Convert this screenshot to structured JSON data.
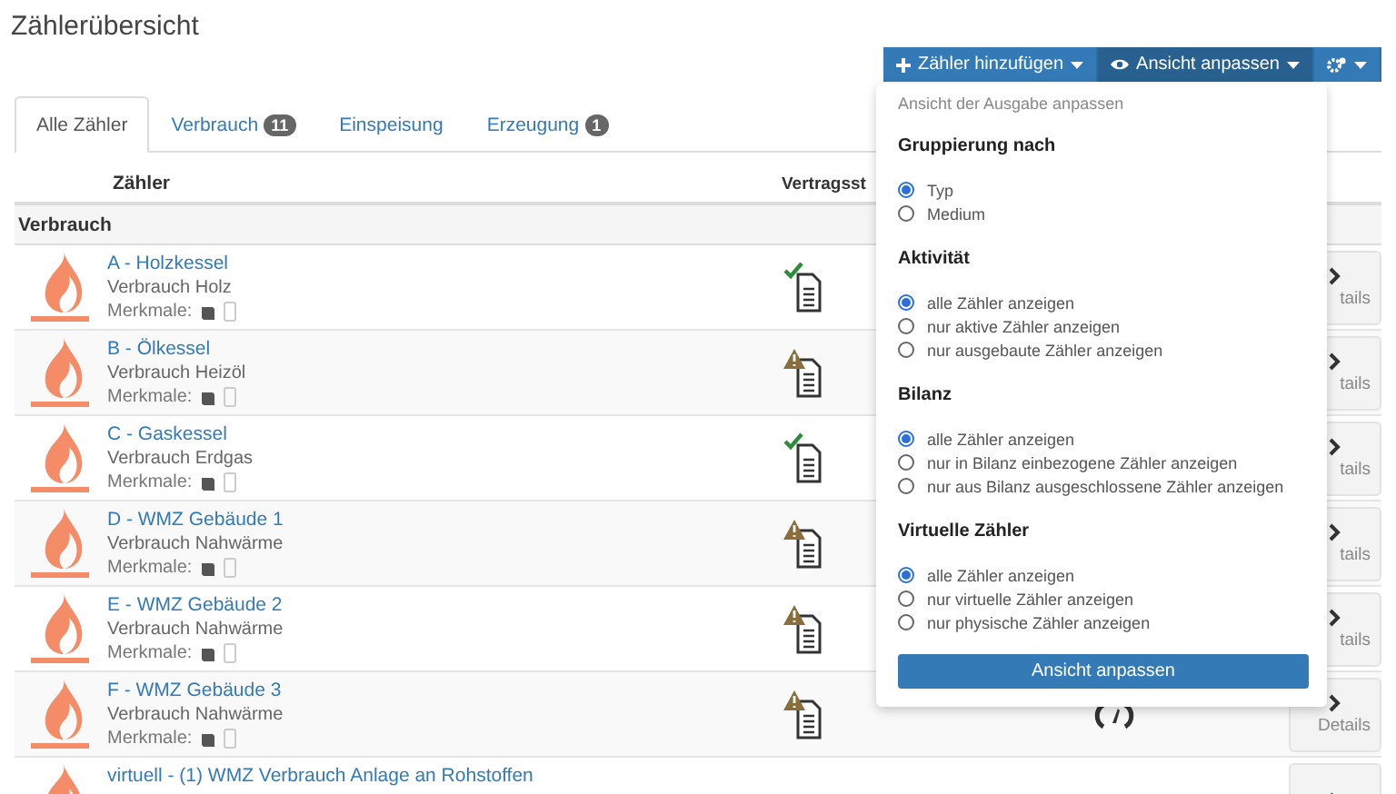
{
  "page": {
    "title": "Zählerübersicht"
  },
  "toolbar": [
    {
      "kind": "add",
      "label": "Zähler hinzufügen",
      "selected": false
    },
    {
      "kind": "view",
      "label": "Ansicht anpassen",
      "selected": true
    },
    {
      "kind": "settings",
      "selected": false
    }
  ],
  "tabs": [
    {
      "label": "Alle Zähler",
      "selected": true
    },
    {
      "label": "Verbrauch",
      "badge": "11",
      "selected": false
    },
    {
      "label": "Einspeisung",
      "selected": false
    },
    {
      "label": "Erzeugung",
      "badge": "1",
      "selected": false
    }
  ],
  "table": {
    "columns": [
      "Zähler",
      "Vertragsst"
    ],
    "group": "Verbrauch",
    "rows": [
      {
        "title": "A - Holzkessel",
        "subtitle": "Verbrauch Holz",
        "features": "Merkmale:",
        "kind": "ok",
        "meter": false,
        "details": "tails"
      },
      {
        "title": "B - Ölkessel",
        "subtitle": "Verbrauch Heizöl",
        "features": "Merkmale:",
        "kind": "warning",
        "meter": false,
        "details": "tails"
      },
      {
        "title": "C - Gaskessel",
        "subtitle": "Verbrauch Erdgas",
        "features": "Merkmale:",
        "kind": "ok",
        "meter": false,
        "details": "tails"
      },
      {
        "title": "D - WMZ Gebäude 1",
        "subtitle": "Verbrauch Nahwärme",
        "features": "Merkmale:",
        "kind": "warning",
        "meter": false,
        "details": "tails"
      },
      {
        "title": "E - WMZ Gebäude 2",
        "subtitle": "Verbrauch Nahwärme",
        "features": "Merkmale:",
        "kind": "warning",
        "meter": false,
        "details": "tails"
      },
      {
        "title": "F - WMZ Gebäude 3",
        "subtitle": "Verbrauch Nahwärme",
        "features": "Merkmale:",
        "kind": "warning",
        "meter": true,
        "details": "Details"
      },
      {
        "title": "virtuell - (1) WMZ Verbrauch Anlage an Rohstoffen",
        "kind": "none",
        "meter": false
      }
    ]
  },
  "view_menu": {
    "header": "Ansicht der Ausgabe anpassen",
    "sections": [
      {
        "title": "Gruppierung nach",
        "options": [
          {
            "label": "Typ",
            "selected": true
          },
          {
            "label": "Medium",
            "selected": false
          }
        ]
      },
      {
        "title": "Aktivität",
        "options": [
          {
            "label": "alle Zähler anzeigen",
            "selected": true
          },
          {
            "label": "nur aktive Zähler anzeigen",
            "selected": false
          },
          {
            "label": "nur ausgebaute Zähler anzeigen",
            "selected": false
          }
        ]
      },
      {
        "title": "Bilanz",
        "options": [
          {
            "label": "alle Zähler anzeigen",
            "selected": true
          },
          {
            "label": "nur in Bilanz einbezogene Zähler anzeigen",
            "selected": false
          },
          {
            "label": "nur aus Bilanz ausgeschlossene Zähler anzeigen",
            "selected": false
          }
        ]
      },
      {
        "title": "Virtuelle Zähler",
        "options": [
          {
            "label": "alle Zähler anzeigen",
            "selected": true
          },
          {
            "label": "nur virtuelle Zähler anzeigen",
            "selected": false
          },
          {
            "label": "nur physische Zähler anzeigen",
            "selected": false
          }
        ]
      }
    ],
    "apply_button": "Ansicht anpassen"
  }
}
